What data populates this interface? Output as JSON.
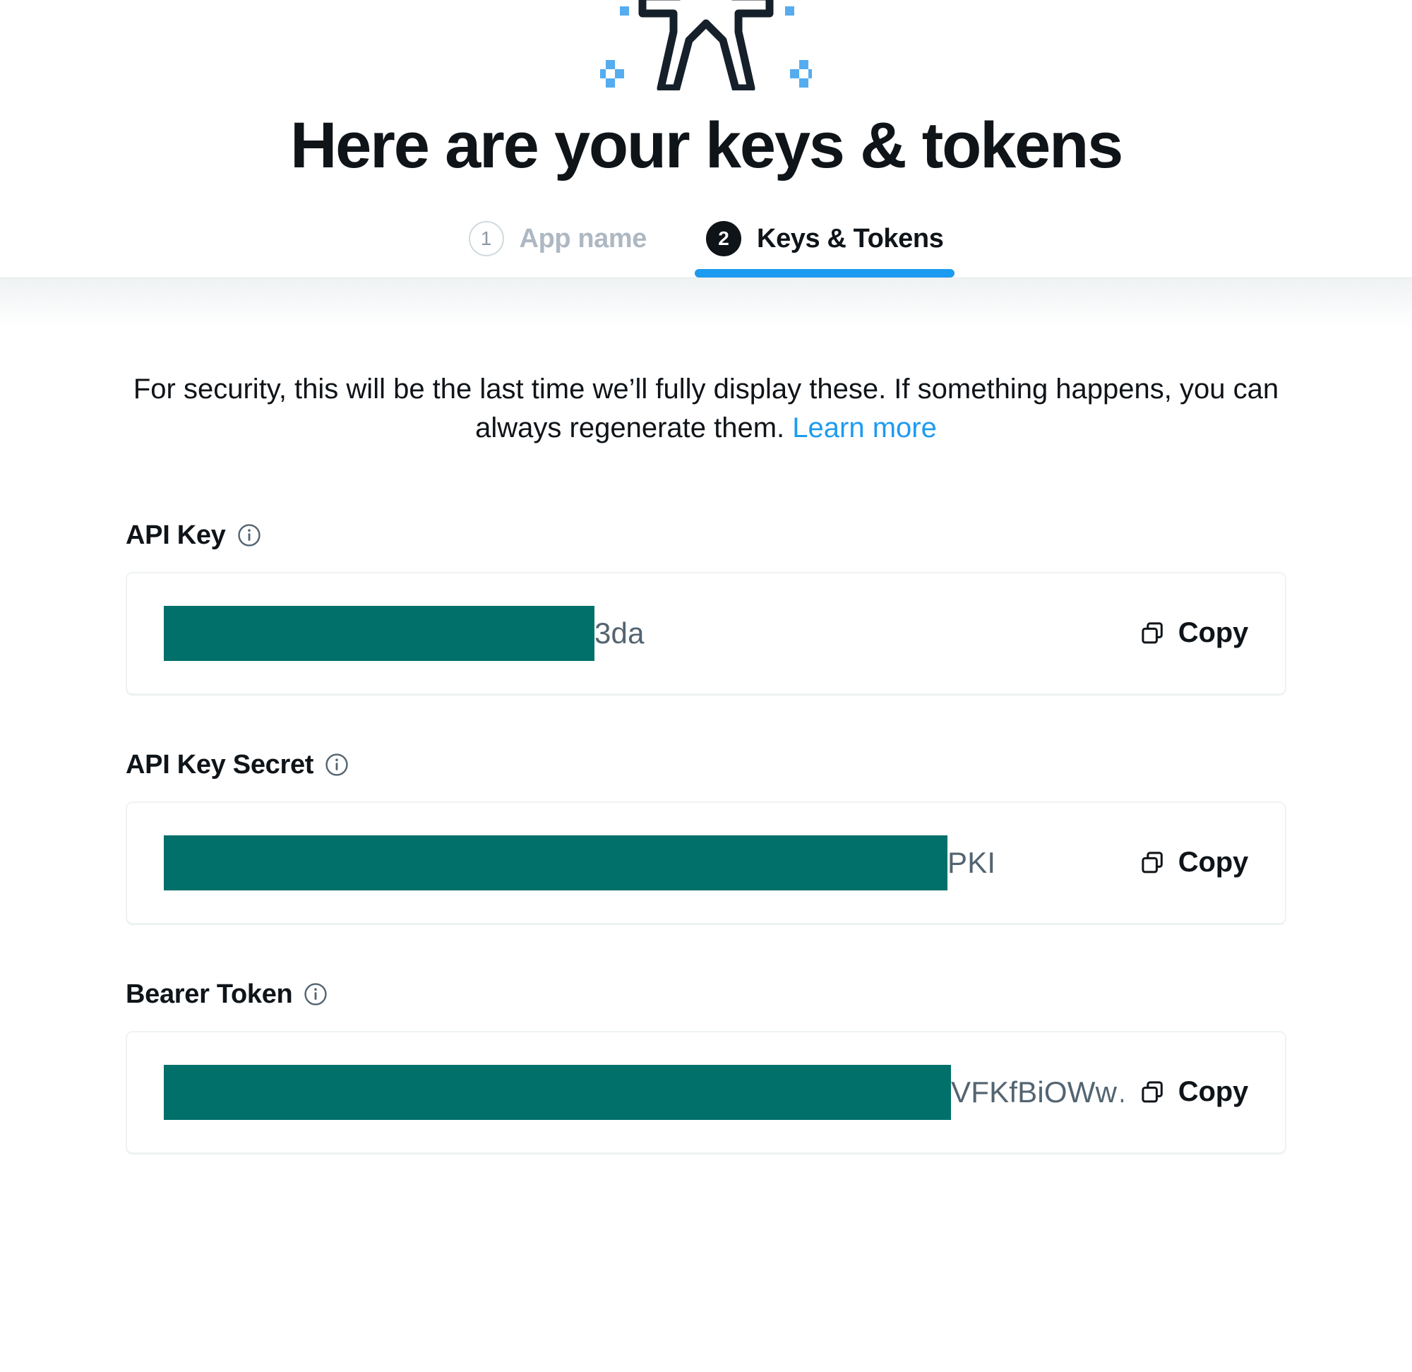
{
  "header": {
    "hero_icon": "person-arms-out-icon",
    "title": "Here are your keys & tokens",
    "steps": [
      {
        "number": "1",
        "label": "App name",
        "state": "inactive"
      },
      {
        "number": "2",
        "label": "Keys & Tokens",
        "state": "active"
      }
    ]
  },
  "notice": {
    "text": "For security, this will be the last time we’ll fully display these. If something happens, you can always regenerate them.",
    "link_label": "Learn more"
  },
  "fields": [
    {
      "label": "API Key",
      "info_icon": "info-circle-icon",
      "redacted": true,
      "visible_value": "3da",
      "copy_label": "Copy",
      "copy_icon": "copy-icon"
    },
    {
      "label": "API Key Secret",
      "info_icon": "info-circle-icon",
      "redacted": true,
      "visible_value": "PKI",
      "copy_label": "Copy",
      "copy_icon": "copy-icon"
    },
    {
      "label": "Bearer Token",
      "info_icon": "info-circle-icon",
      "redacted": true,
      "visible_value": "VFKfBiOWw…",
      "copy_label": "Copy",
      "copy_icon": "copy-icon"
    }
  ],
  "colors": {
    "accent_blue": "#1d9bf0",
    "text_primary": "#0f1419",
    "text_muted": "#536471",
    "step_inactive": "#aeb8c2",
    "redaction_teal": "#01706a",
    "border": "#eff3f4"
  }
}
